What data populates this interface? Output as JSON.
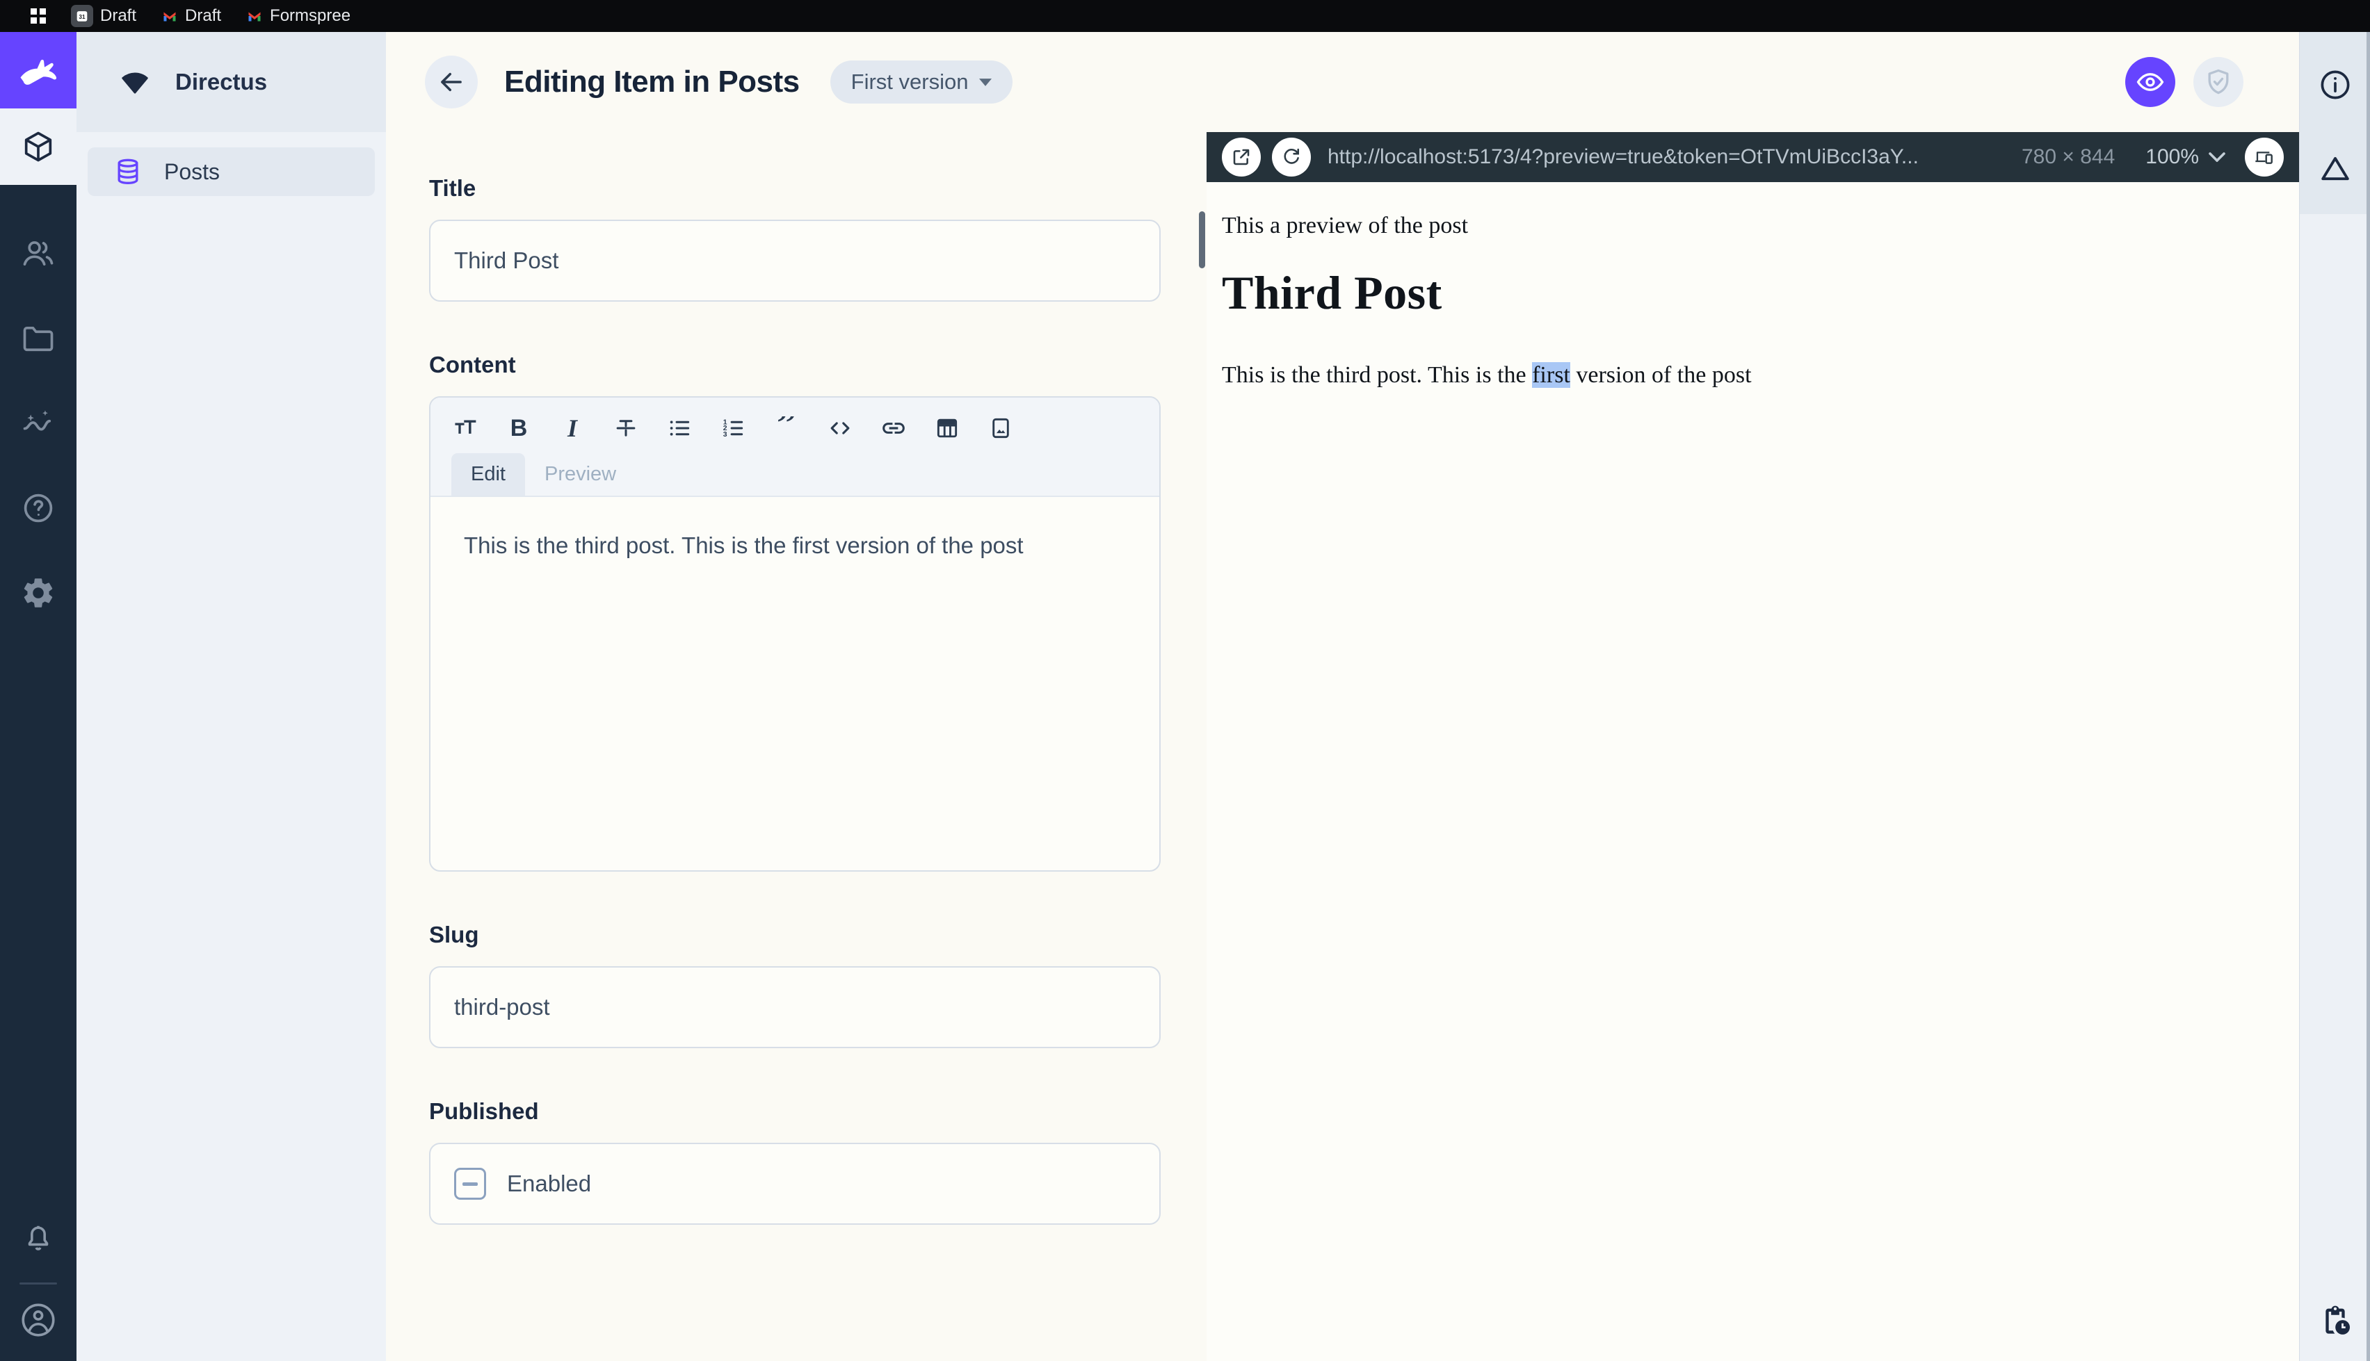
{
  "colors": {
    "accent": "#6644ff",
    "module_bar": "#1b2a3b",
    "url_bar": "#25323a",
    "selection_highlight": "#a9c7f5"
  },
  "browser": {
    "tabs": [
      {
        "icon": "google-calendar",
        "label": "Draft"
      },
      {
        "icon": "gmail",
        "label": "Draft"
      },
      {
        "icon": "gmail",
        "label": "Formspree"
      }
    ]
  },
  "module_bar": {
    "items": [
      "directus-logo",
      "content-module",
      "users-module",
      "files-module",
      "insights-module",
      "docs-module",
      "settings-module"
    ],
    "bottom": [
      "notifications-bell",
      "user-avatar"
    ]
  },
  "sidebar": {
    "project": "Directus",
    "items": [
      {
        "icon": "database",
        "label": "Posts"
      }
    ]
  },
  "header": {
    "title": "Editing Item in Posts",
    "version_label": "First version"
  },
  "form": {
    "title": {
      "label": "Title",
      "value": "Third Post"
    },
    "content": {
      "label": "Content",
      "toolbar_icons": [
        "format-size",
        "bold",
        "italic",
        "strikethrough",
        "bullet-list",
        "ordered-list",
        "blockquote",
        "code",
        "link",
        "table",
        "image"
      ],
      "tabs": [
        "Edit",
        "Preview"
      ],
      "value": "This is the third post. This is the first version of the post"
    },
    "slug": {
      "label": "Slug",
      "value": "third-post"
    },
    "published": {
      "label": "Published",
      "checkbox_label": "Enabled",
      "checkbox_state": "indeterminate"
    }
  },
  "preview": {
    "url": "http://localhost:5173/4?preview=true&token=OtTVmUiBccI3aY...",
    "size_label": "780 × 844",
    "zoom_label": "100%",
    "content": {
      "intro": "This a preview of the post",
      "heading": "Third Post",
      "body_before": "This is the third post. This is the ",
      "highlight": "first",
      "body_after": " version of the post"
    }
  }
}
